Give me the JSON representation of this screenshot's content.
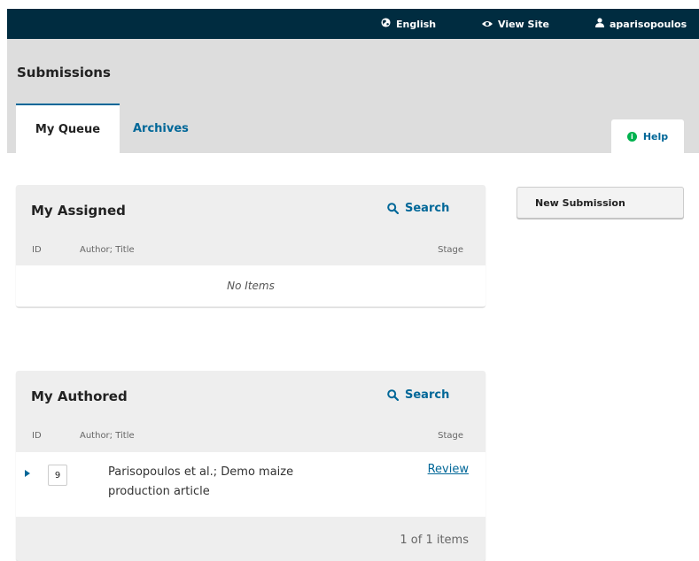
{
  "topbar": {
    "language": "English",
    "view_site": "View Site",
    "username": "aparisopoulos",
    "language_icon": "globe-icon",
    "view_site_icon": "eye-icon",
    "user_icon": "user-icon"
  },
  "page": {
    "title": "Submissions"
  },
  "tabs": [
    {
      "label": "My Queue",
      "active": true
    },
    {
      "label": "Archives",
      "active": false
    }
  ],
  "help": {
    "label": "Help",
    "icon": "info-icon"
  },
  "actions": {
    "new_submission": "New Submission"
  },
  "assigned": {
    "title": "My Assigned",
    "search_label": "Search",
    "columns": {
      "id": "ID",
      "author_title": "Author; Title",
      "stage": "Stage"
    },
    "empty_text": "No Items"
  },
  "authored": {
    "title": "My Authored",
    "search_label": "Search",
    "columns": {
      "id": "ID",
      "author_title": "Author; Title",
      "stage": "Stage"
    },
    "rows": [
      {
        "id": "9",
        "author_title": "Parisopoulos et al.; Demo maize production article",
        "stage": "Review"
      }
    ],
    "pagination": "1 of 1 items"
  },
  "colors": {
    "topbar": "#002c40",
    "accent": "#006798",
    "help_icon": "#00b24e",
    "header_bg": "#dddddd",
    "panel_bg": "#eeeeee"
  }
}
